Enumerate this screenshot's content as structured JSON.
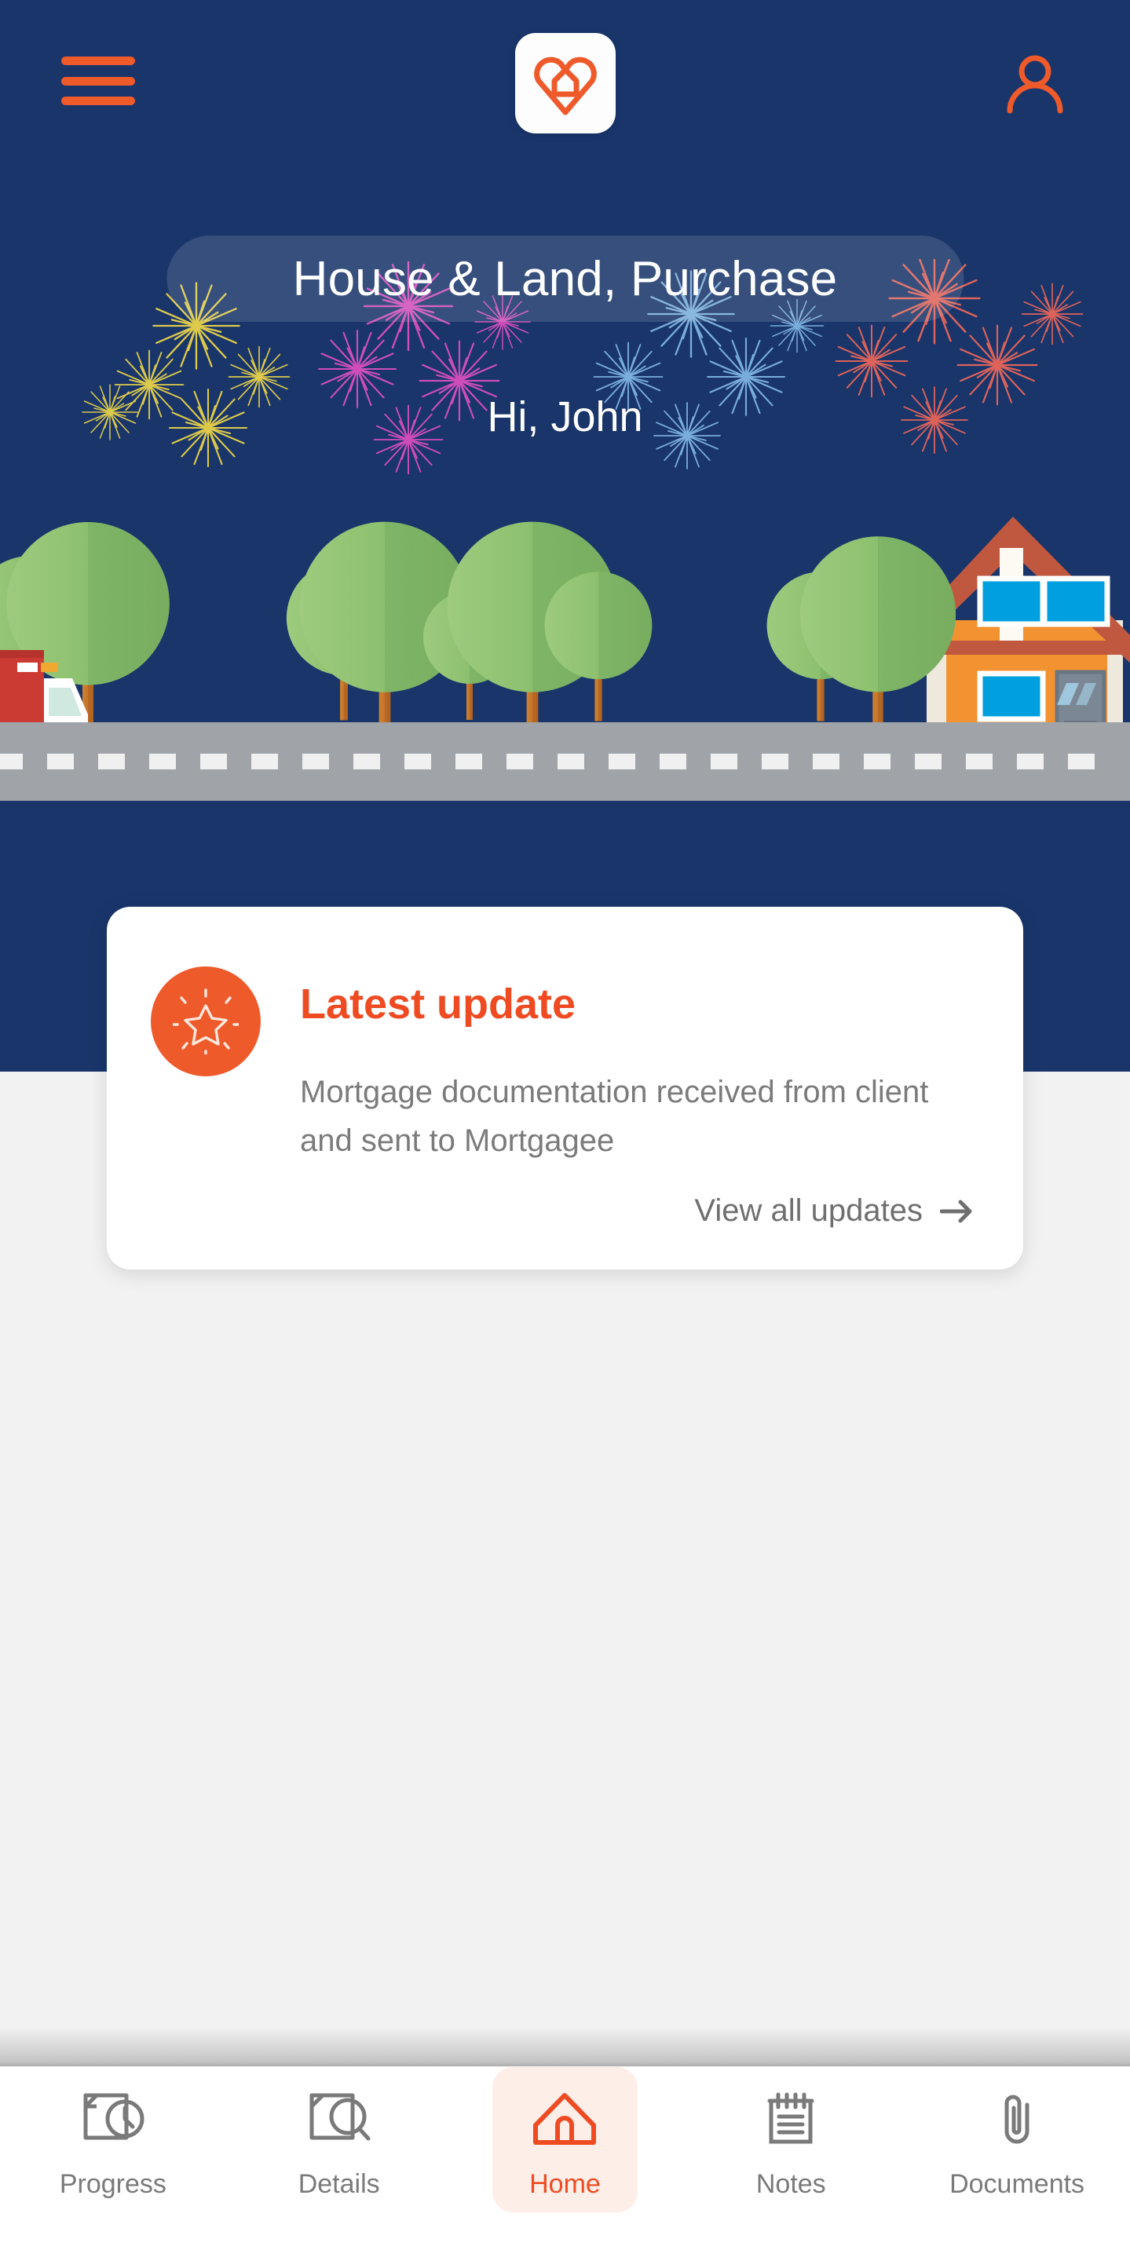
{
  "colors": {
    "brand_orange": "#ef5a2b",
    "brand_orange_text": "#ef4b22",
    "hero_navy": "#19356a",
    "body_bg": "#f2f2f2",
    "card_white": "#ffffff",
    "nav_inactive": "#7a7a7a",
    "nav_active_bg": "#fdeee8",
    "road_grey": "#a0a4a8",
    "house_orange": "#f29230",
    "house_roof": "#c0583f",
    "house_window": "#00a0e0",
    "truck_red": "#cc3b33",
    "tree_green": "#8cc06e",
    "tree_trunk": "#c4752a"
  },
  "header": {
    "menu_icon": "hamburger-menu-icon",
    "logo_icon": "heart-house-logo-icon",
    "profile_icon": "user-profile-icon"
  },
  "hero": {
    "title": "House & Land, Purchase",
    "greeting": "Hi, John",
    "illustration": {
      "name": "moving-day-scene",
      "elements": [
        "fireworks",
        "trees",
        "moving-truck",
        "house",
        "road"
      ]
    },
    "fireworks_colors": [
      "#e8d24a",
      "#d94fc0",
      "#7fb4e0",
      "#e8665a"
    ]
  },
  "update_card": {
    "icon": "sparkle-star-icon",
    "title": "Latest update",
    "body": "Mortgage documentation received from client and sent to Mortgagee",
    "link_label": "View all updates",
    "link_icon": "arrow-right-icon"
  },
  "bottom_nav": {
    "items": [
      {
        "label": "Progress",
        "icon": "document-clock-icon",
        "active": false
      },
      {
        "label": "Details",
        "icon": "document-search-icon",
        "active": false
      },
      {
        "label": "Home",
        "icon": "home-icon",
        "active": true
      },
      {
        "label": "Notes",
        "icon": "notepad-icon",
        "active": false
      },
      {
        "label": "Documents",
        "icon": "paperclip-icon",
        "active": false
      }
    ]
  }
}
